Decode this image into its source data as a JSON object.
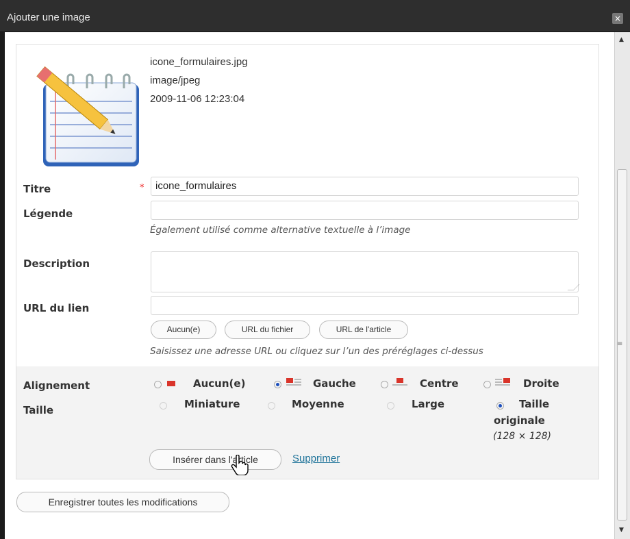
{
  "window": {
    "title": "Ajouter une image",
    "close_glyph": "×"
  },
  "file": {
    "name": "icone_formulaires.jpg",
    "mime": "image/jpeg",
    "date": "2009-11-06 12:23:04",
    "thumbnail_icon": "notepad-pencil-icon"
  },
  "fields": {
    "title_label": "Titre",
    "title_value": "icone_formulaires",
    "required_mark": "*",
    "caption_label": "Légende",
    "caption_help": "Également utilisé comme alternative textuelle à l’image",
    "description_label": "Description",
    "url_label": "URL du lien",
    "url_buttons": [
      "Aucun(e)",
      "URL du fichier",
      "URL de l'article"
    ],
    "url_help": "Saisissez une adresse URL ou cliquez sur l’un des préréglages ci-dessus"
  },
  "alignment": {
    "label": "Alignement",
    "options": [
      "Aucun(e)",
      "Gauche",
      "Centre",
      "Droite"
    ],
    "selected": "Gauche"
  },
  "size": {
    "label": "Taille",
    "options": [
      "Miniature",
      "Moyenne",
      "Large",
      "Taille",
      "originale"
    ],
    "dimensions": "(128 × 128)",
    "selected": "Taille originale"
  },
  "actions": {
    "insert": "Insérer dans l'article",
    "delete": "Supprimer",
    "save_all": "Enregistrer toutes les modifications"
  },
  "colors": {
    "accent_red": "#d9342a",
    "link": "#21759b",
    "radio_selected": "#1d4fbc"
  }
}
